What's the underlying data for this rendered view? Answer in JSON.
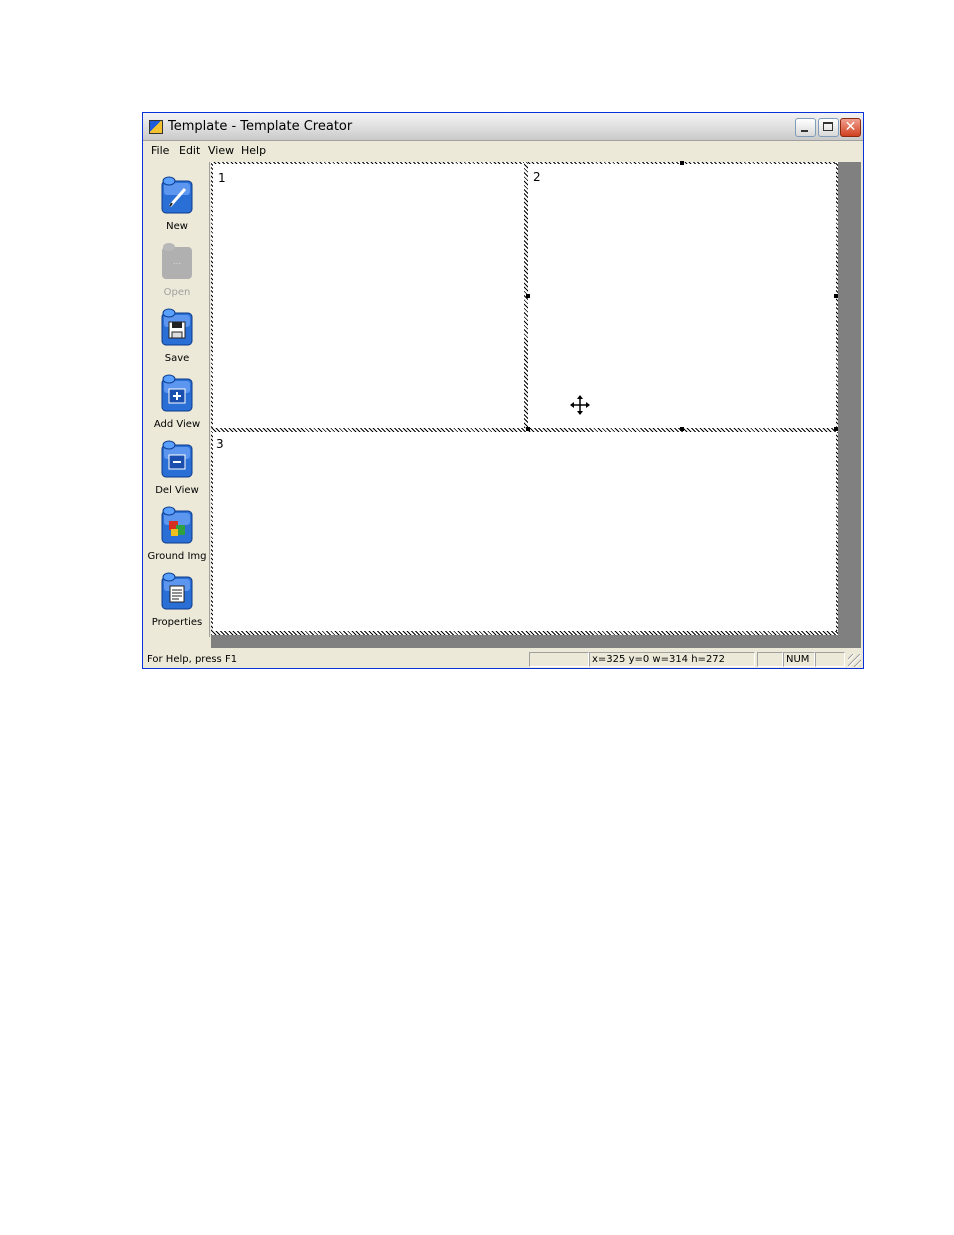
{
  "window": {
    "title": "Template - Template Creator"
  },
  "menu": [
    {
      "label": "File"
    },
    {
      "label": "Edit"
    },
    {
      "label": "View"
    },
    {
      "label": "Help"
    }
  ],
  "toolbar": [
    {
      "label": "New",
      "icon": "pencil-icon",
      "enabled": true
    },
    {
      "label": "Open",
      "icon": "folder-icon",
      "enabled": false
    },
    {
      "label": "Save",
      "icon": "floppy-icon",
      "enabled": true
    },
    {
      "label": "Add View",
      "icon": "add-view-icon",
      "enabled": true
    },
    {
      "label": "Del View",
      "icon": "delete-view-icon",
      "enabled": true
    },
    {
      "label": "Ground Img",
      "icon": "ground-image-icon",
      "enabled": true
    },
    {
      "label": "Properties",
      "icon": "properties-icon",
      "enabled": true
    }
  ],
  "views": [
    {
      "number": "1"
    },
    {
      "number": "2"
    },
    {
      "number": "3"
    }
  ],
  "status": {
    "help_text": "For Help, press F1",
    "coords": "x=325 y=0 w=314 h=272",
    "num": "NUM"
  },
  "colors": {
    "button_blue": "#2a6fd6",
    "window_border": "#0831d9",
    "close_red": "#d04020"
  }
}
